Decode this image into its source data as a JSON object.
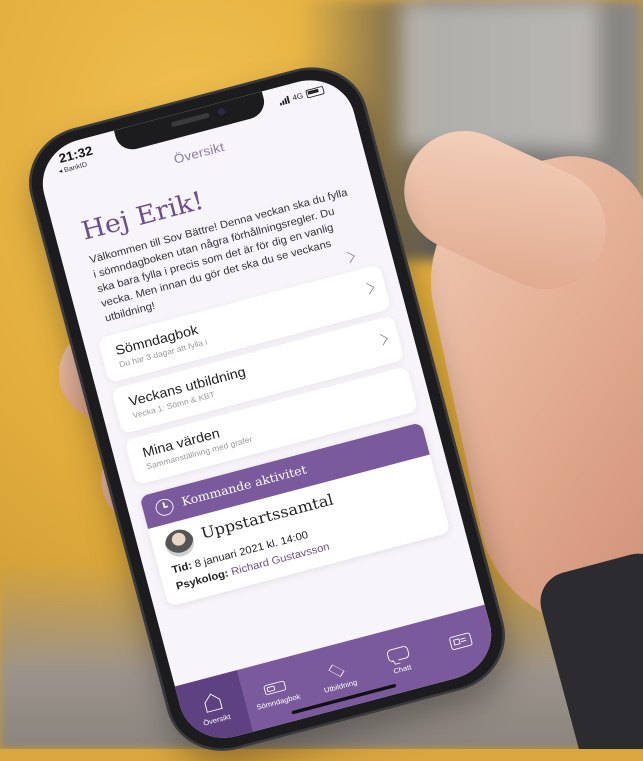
{
  "status": {
    "time": "21:32",
    "back_label": "◂ BankID",
    "network": "4G"
  },
  "header": {
    "title": "Översikt"
  },
  "greeting": "Hej Erik!",
  "intro": "Välkommen till Sov Bättre! Denna veckan ska du fylla i sömndagboken utan några förhållningsregler. Du ska bara fylla i precis som det är för dig en vanlig vecka. Men innan du gör det ska du se veckans utbildning!",
  "cards": [
    {
      "title": "Sömndagbok",
      "subtitle": "Du har 3 dagar att fylla i"
    },
    {
      "title": "Veckans utbildning",
      "subtitle": "Vecka 1: Sömn & KBT"
    },
    {
      "title": "Mina värden",
      "subtitle": "Sammanställning med grafer"
    }
  ],
  "activity": {
    "header": "Kommande aktivitet",
    "title": "Uppstartssamtal",
    "datetime": "8 januari 2021 kl. 14:00",
    "time_label": "Tid:",
    "psychologist_label": "Psykolog:",
    "psychologist": "Richard Gustavsson"
  },
  "tabs": [
    {
      "label": "Översikt",
      "icon": "house-icon",
      "active": true
    },
    {
      "label": "Sömndagbok",
      "icon": "bed-icon"
    },
    {
      "label": "Utbildning",
      "icon": "graduation-cap-icon"
    },
    {
      "label": "Chatt",
      "icon": "chat-icon"
    },
    {
      "label": "",
      "icon": "id-card-icon"
    }
  ],
  "colors": {
    "brand": "#7a5a9c",
    "brand_dark": "#5e4180",
    "title": "#6a4f8c"
  }
}
